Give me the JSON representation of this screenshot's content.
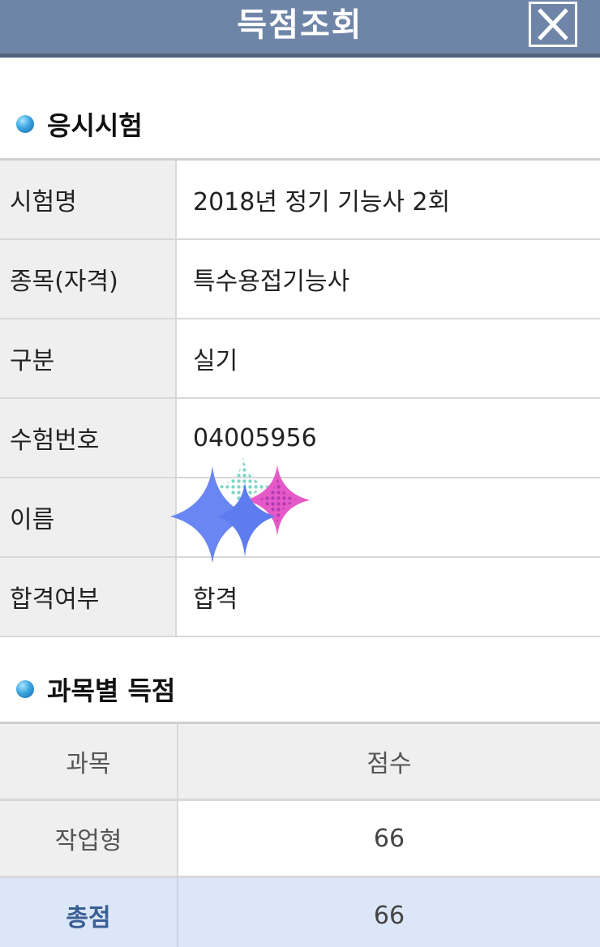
{
  "header": {
    "title": "득점조회",
    "close_icon": "close-icon"
  },
  "exam_section": {
    "title": "응시시험",
    "rows": [
      {
        "label": "시험명",
        "value": "2018년 정기 기능사 2회"
      },
      {
        "label": "종목(자격)",
        "value": "특수용접기능사"
      },
      {
        "label": "구분",
        "value": "실기"
      },
      {
        "label": "수험번호",
        "value": "04005956"
      },
      {
        "label": "이름",
        "value": ""
      },
      {
        "label": "합격여부",
        "value": "합격"
      }
    ]
  },
  "score_section": {
    "title": "과목별 득점",
    "columns": [
      "과목",
      "점수"
    ],
    "rows": [
      {
        "subject": "작업형",
        "score": "66"
      }
    ],
    "total": {
      "label": "총점",
      "score": "66"
    }
  },
  "colors": {
    "header_bg": "#6f85a8",
    "total_row_bg": "#dbe6f8",
    "total_label": "#3a5f95",
    "bullet": "#3ba5e0"
  }
}
